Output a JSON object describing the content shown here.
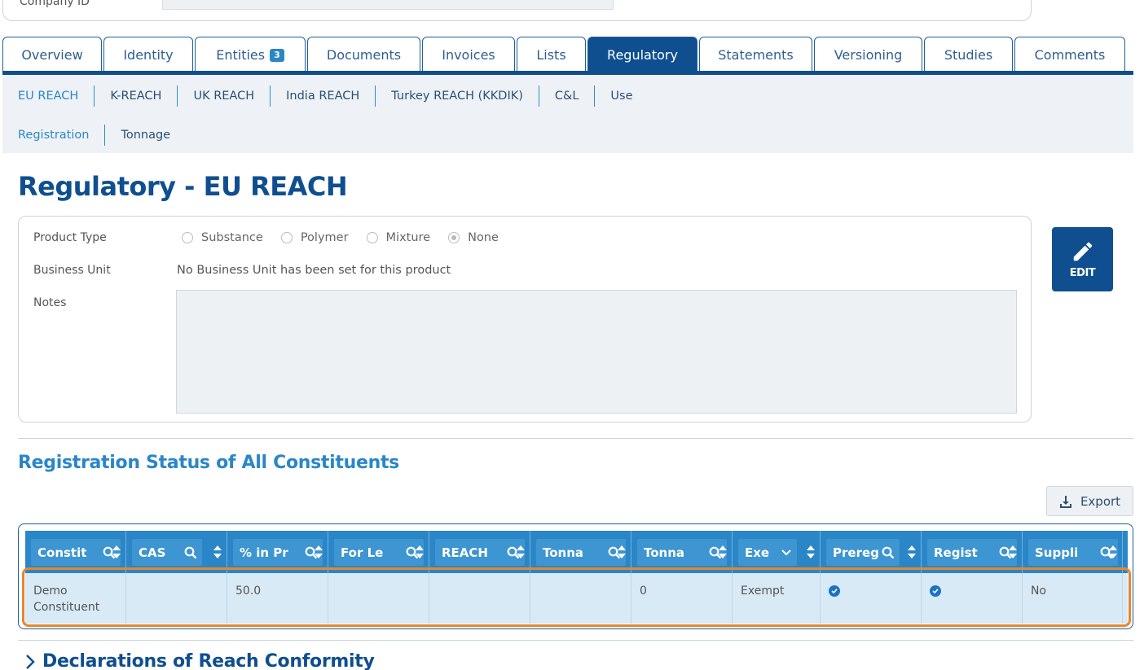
{
  "top": {
    "company_id_label": "Company ID"
  },
  "tabs": [
    {
      "label": "Overview"
    },
    {
      "label": "Identity"
    },
    {
      "label": "Entities",
      "badge": "3"
    },
    {
      "label": "Documents"
    },
    {
      "label": "Invoices"
    },
    {
      "label": "Lists"
    },
    {
      "label": "Regulatory",
      "active": true
    },
    {
      "label": "Statements"
    },
    {
      "label": "Versioning"
    },
    {
      "label": "Studies"
    },
    {
      "label": "Comments"
    }
  ],
  "subnav": {
    "row1": [
      {
        "label": "EU REACH",
        "active": true
      },
      {
        "label": "K-REACH"
      },
      {
        "label": "UK REACH"
      },
      {
        "label": "India REACH"
      },
      {
        "label": "Turkey REACH (KKDIK)"
      },
      {
        "label": "C&L"
      },
      {
        "label": "Use"
      }
    ],
    "row2": [
      {
        "label": "Registration",
        "active": true
      },
      {
        "label": "Tonnage"
      }
    ]
  },
  "page_title": "Regulatory - EU REACH",
  "form": {
    "product_type_label": "Product Type",
    "product_type_options": [
      "Substance",
      "Polymer",
      "Mixture",
      "None"
    ],
    "product_type_selected": "None",
    "business_unit_label": "Business Unit",
    "business_unit_value": "No Business Unit has been set for this product",
    "notes_label": "Notes",
    "notes_value": ""
  },
  "edit_button": {
    "label": "EDIT"
  },
  "registration": {
    "title": "Registration Status of All Constituents",
    "export_label": "Export",
    "columns": [
      "Constituent",
      "CAS",
      "% in Product",
      "For Legal Entity",
      "REACH",
      "Tonnage",
      "Tonnage",
      "Exempt",
      "Preregistered",
      "Registered",
      "Supplier"
    ],
    "columns_visible": [
      "Constit",
      "CAS",
      "% in Pr",
      "For Le",
      "REACH",
      "Tonna",
      "Tonna",
      "Exe",
      "Prereg",
      "Regist",
      "Suppli"
    ],
    "rows": [
      {
        "constituent": "Demo Constituent",
        "cas": "",
        "percent": "50.0",
        "for_legal": "",
        "reach": "",
        "tonnage1": "",
        "tonnage2": "0",
        "exempt": "Exempt",
        "prereg": true,
        "registered": true,
        "supplier": "No"
      }
    ]
  },
  "declarations": {
    "title": "Declarations of Reach Conformity"
  },
  "colors": {
    "primary": "#0f4f8f",
    "accent": "#2a86c7",
    "highlight": "#e5862f"
  }
}
